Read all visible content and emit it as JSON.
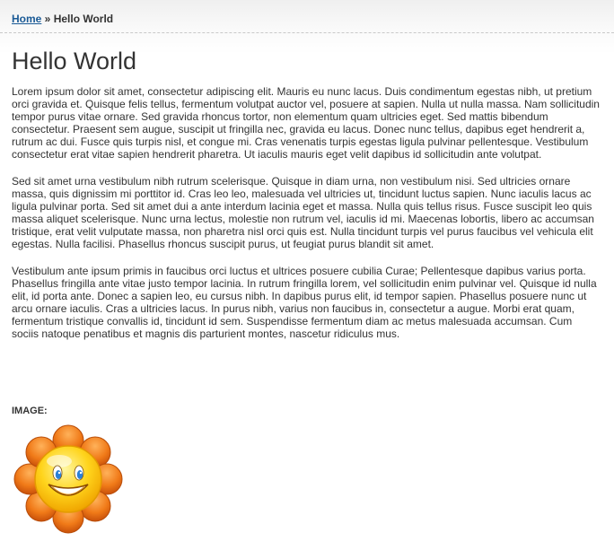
{
  "breadcrumb": {
    "home_label": "Home",
    "separator": " » ",
    "current": "Hello World"
  },
  "page": {
    "title": "Hello World",
    "paragraphs": [
      "Lorem ipsum dolor sit amet, consectetur adipiscing elit. Mauris eu nunc lacus. Duis condimentum egestas nibh, ut pretium orci gravida et. Quisque felis tellus, fermentum volutpat auctor vel, posuere at sapien. Nulla ut nulla massa. Nam sollicitudin tempor purus vitae ornare. Sed gravida rhoncus tortor, non elementum quam ultricies eget. Sed mattis bibendum consectetur. Praesent sem augue, suscipit ut fringilla nec, gravida eu lacus. Donec nunc tellus, dapibus eget hendrerit a, rutrum ac dui. Fusce quis turpis nisl, et congue mi. Cras venenatis turpis egestas ligula pulvinar pellentesque. Vestibulum consectetur erat vitae sapien hendrerit pharetra. Ut iaculis mauris eget velit dapibus id sollicitudin ante volutpat.",
      "Sed sit amet urna vestibulum nibh rutrum scelerisque. Quisque in diam urna, non vestibulum nisi. Sed ultricies ornare massa, quis dignissim mi porttitor id. Cras leo leo, malesuada vel ultricies ut, tincidunt luctus sapien. Nunc iaculis lacus ac ligula pulvinar porta. Sed sit amet dui a ante interdum lacinia eget et massa. Nulla quis tellus risus. Fusce suscipit leo quis massa aliquet scelerisque. Nunc urna lectus, molestie non rutrum vel, iaculis id mi. Maecenas lobortis, libero ac accumsan tristique, erat velit vulputate massa, non pharetra nisl orci quis est. Nulla tincidunt turpis vel purus faucibus vel vehicula elit egestas. Nulla facilisi. Phasellus rhoncus suscipit purus, ut feugiat purus blandit sit amet.",
      "Vestibulum ante ipsum primis in faucibus orci luctus et ultrices posuere cubilia Curae; Pellentesque dapibus varius porta. Phasellus fringilla ante vitae justo tempor lacinia. In rutrum fringilla lorem, vel sollicitudin enim pulvinar vel. Quisque id nulla elit, id porta ante. Donec a sapien leo, eu cursus nibh. In dapibus purus elit, id tempor sapien. Phasellus posuere nunc ut arcu ornare iaculis. Cras a ultricies lacus. In purus nibh, varius non faucibus in, consectetur a augue. Morbi erat quam, fermentum tristique convallis id, tincidunt id sem. Suspendisse fermentum diam ac metus malesuada accumsan. Cum sociis natoque penatibus et magnis dis parturient montes, nascetur ridiculus mus."
    ],
    "image_label": "IMAGE:",
    "image_icon": "smiling-sun-icon"
  },
  "colors": {
    "link": "#1a5a96",
    "text": "#333333",
    "sun_petal": "#e86a10",
    "sun_face": "#ffd21f"
  }
}
